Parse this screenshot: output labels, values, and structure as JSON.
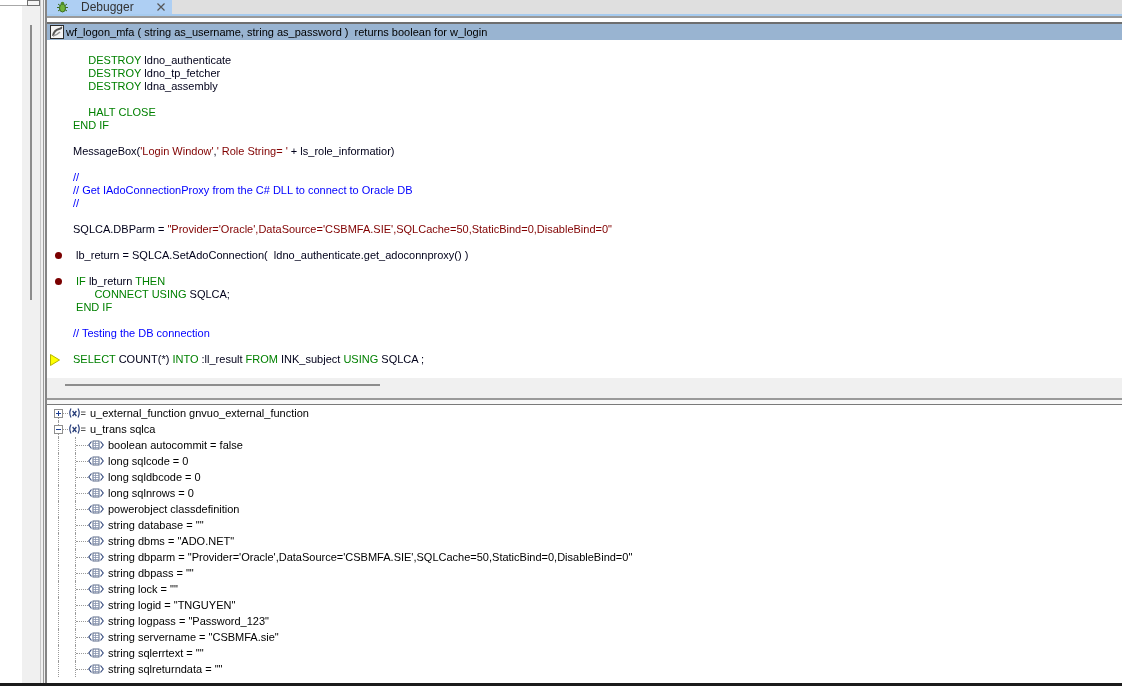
{
  "tabs": [
    {
      "label": "Debugger",
      "selected": true
    }
  ],
  "header": {
    "signature": "wf_logon_mfa ( string as_username, string as_password )  returns boolean for w_login"
  },
  "code": {
    "blocks": [
      {
        "lines": [
          {
            "breakpoint": false,
            "current": false,
            "segments": [
              {
                "kind": "keyword",
                "text": "     DESTROY"
              },
              {
                "kind": "plain",
                "text": " ldno_authenticate"
              }
            ]
          },
          {
            "breakpoint": false,
            "current": false,
            "segments": [
              {
                "kind": "keyword",
                "text": "     DESTROY"
              },
              {
                "kind": "plain",
                "text": " ldno_tp_fetcher"
              }
            ]
          },
          {
            "breakpoint": false,
            "current": false,
            "segments": [
              {
                "kind": "keyword",
                "text": "     DESTROY"
              },
              {
                "kind": "plain",
                "text": " ldna_assembly"
              }
            ]
          }
        ]
      },
      {
        "lines": [
          {
            "breakpoint": false,
            "current": false,
            "segments": [
              {
                "kind": "keyword",
                "text": "     HALT CLOSE"
              }
            ]
          },
          {
            "breakpoint": false,
            "current": false,
            "segments": [
              {
                "kind": "keyword",
                "text": "END IF"
              }
            ]
          }
        ]
      },
      {
        "lines": [
          {
            "breakpoint": false,
            "current": false,
            "segments": [
              {
                "kind": "plain",
                "text": "MessageBox("
              },
              {
                "kind": "string",
                "text": "'Login Window'"
              },
              {
                "kind": "plain",
                "text": ","
              },
              {
                "kind": "string",
                "text": "' Role String= '"
              },
              {
                "kind": "plain",
                "text": " + ls_role_informatior)"
              }
            ]
          }
        ]
      },
      {
        "lines": [
          {
            "breakpoint": false,
            "current": false,
            "segments": [
              {
                "kind": "comment",
                "text": "//"
              }
            ]
          },
          {
            "breakpoint": false,
            "current": false,
            "segments": [
              {
                "kind": "comment",
                "text": "// Get IAdoConnectionProxy from the C# DLL to connect to Oracle DB"
              }
            ]
          },
          {
            "breakpoint": false,
            "current": false,
            "segments": [
              {
                "kind": "comment",
                "text": "//"
              }
            ]
          }
        ]
      },
      {
        "lines": [
          {
            "breakpoint": false,
            "current": false,
            "segments": [
              {
                "kind": "plain",
                "text": "SQLCA.DBParm = "
              },
              {
                "kind": "string",
                "text": "\"Provider='Oracle',DataSource='CSBMFA.SIE',SQLCache=50,StaticBind=0,DisableBind=0\""
              }
            ]
          }
        ]
      },
      {
        "lines": [
          {
            "breakpoint": true,
            "current": false,
            "segments": [
              {
                "kind": "plain",
                "text": " lb_return = SQLCA.SetAdoConnection(  ldno_authenticate.get_adoconnproxy() )"
              }
            ]
          }
        ]
      },
      {
        "lines": [
          {
            "breakpoint": true,
            "current": false,
            "segments": [
              {
                "kind": "keyword",
                "text": " IF"
              },
              {
                "kind": "plain",
                "text": " lb_return "
              },
              {
                "kind": "keyword",
                "text": "THEN"
              }
            ]
          },
          {
            "breakpoint": false,
            "current": false,
            "segments": [
              {
                "kind": "keyword",
                "text": "       CONNECT USING"
              },
              {
                "kind": "plain",
                "text": " SQLCA;"
              }
            ]
          },
          {
            "breakpoint": false,
            "current": false,
            "segments": [
              {
                "kind": "keyword",
                "text": " END IF"
              }
            ]
          }
        ]
      },
      {
        "lines": [
          {
            "breakpoint": false,
            "current": false,
            "segments": [
              {
                "kind": "comment",
                "text": "// Testing the DB connection"
              }
            ]
          }
        ]
      },
      {
        "lines": [
          {
            "breakpoint": false,
            "current": true,
            "segments": [
              {
                "kind": "keyword",
                "text": "SELECT"
              },
              {
                "kind": "plain",
                "text": " COUNT(*) "
              },
              {
                "kind": "keyword",
                "text": "INTO"
              },
              {
                "kind": "plain",
                "text": " :ll_result "
              },
              {
                "kind": "keyword",
                "text": "FROM"
              },
              {
                "kind": "plain",
                "text": " INK_subject "
              },
              {
                "kind": "keyword",
                "text": "USING"
              },
              {
                "kind": "plain",
                "text": " SQLCA ;"
              }
            ]
          }
        ]
      }
    ]
  },
  "variables": [
    {
      "label": "u_external_function gnvuo_external_function",
      "expanded": false
    },
    {
      "label": "u_trans sqlca",
      "expanded": true,
      "children": [
        {
          "label": "boolean autocommit = false"
        },
        {
          "label": "long sqlcode = 0"
        },
        {
          "label": "long sqldbcode = 0"
        },
        {
          "label": "long sqlnrows = 0"
        },
        {
          "label": "powerobject classdefinition"
        },
        {
          "label": "string database = \"\""
        },
        {
          "label": "string dbms = \"ADO.NET\""
        },
        {
          "label": "string dbparm = \"Provider='Oracle',DataSource='CSBMFA.SIE',SQLCache=50,StaticBind=0,DisableBind=0\""
        },
        {
          "label": "string dbpass = \"\""
        },
        {
          "label": "string lock = \"\""
        },
        {
          "label": "string logid = \"TNGUYEN\""
        },
        {
          "label": "string logpass = \"Password_123\""
        },
        {
          "label": "string servername = \"CSBMFA.sie\""
        },
        {
          "label": "string sqlerrtext = \"\""
        },
        {
          "label": "string sqlreturndata = \"\""
        }
      ]
    }
  ]
}
